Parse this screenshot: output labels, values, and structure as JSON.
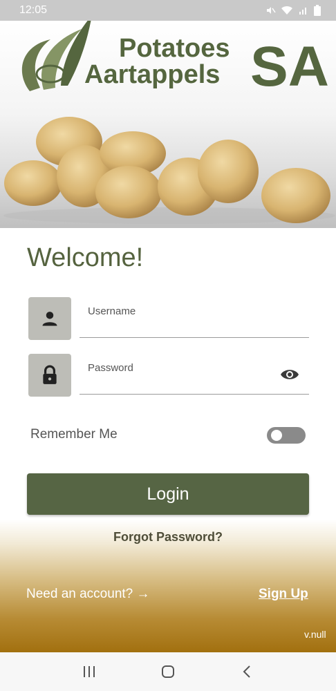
{
  "status_bar": {
    "time": "12:05",
    "icons": [
      "mute-icon",
      "wifi-icon",
      "signal-icon",
      "battery-icon"
    ]
  },
  "branding": {
    "line1": "Potatoes",
    "line2": "Aartappels",
    "suffix": "SA",
    "color": "#55663f"
  },
  "form": {
    "welcome": "Welcome!",
    "username_label": "Username",
    "password_label": "Password",
    "remember_label": "Remember Me",
    "remember_enabled": false,
    "login_label": "Login",
    "forgot_label": "Forgot Password?",
    "need_account_label": "Need an account? →",
    "signup_label": "Sign Up",
    "version": "v.null"
  },
  "colors": {
    "primary": "#566544",
    "icon_bg": "#bdbdb7",
    "accent_gold": "#a2700f"
  },
  "nav": {
    "buttons": [
      "recent-apps-icon",
      "home-icon",
      "back-icon"
    ]
  }
}
